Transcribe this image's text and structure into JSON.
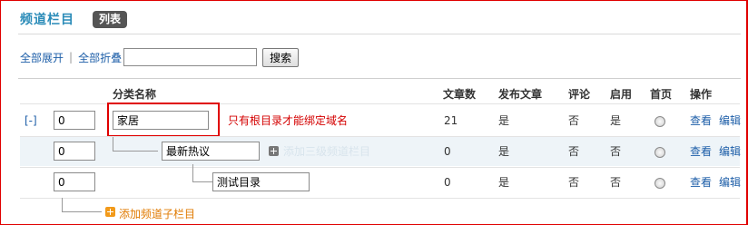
{
  "header": {
    "title": "频道栏目",
    "badge": "列表"
  },
  "toolbar": {
    "expand_all": "全部展开",
    "separator": "|",
    "collapse_all": "全部折叠",
    "search_value": "",
    "search_button": "搜索"
  },
  "columns": {
    "name": "分类名称",
    "articles": "文章数",
    "publish": "发布文章",
    "comment": "评论",
    "enabled": "启用",
    "home": "首页",
    "actions": "操作"
  },
  "rows": [
    {
      "toggle": "[-]",
      "order": "0",
      "name": "家居",
      "hint": "只有根目录才能绑定域名",
      "articles": "21",
      "publish": "是",
      "comment": "否",
      "enabled": "是",
      "home_selected": false,
      "view": "查看",
      "edit": "编辑"
    },
    {
      "order": "0",
      "name": "最新热议",
      "ghost_text": "添加三级频道栏目",
      "articles": "0",
      "publish": "是",
      "comment": "否",
      "enabled": "否",
      "home_selected": false,
      "view": "查看",
      "edit": "编辑"
    },
    {
      "order": "0",
      "name": "测试目录",
      "articles": "0",
      "publish": "是",
      "comment": "否",
      "enabled": "否",
      "home_selected": false,
      "view": "查看",
      "edit": "编辑"
    }
  ],
  "add_sub_channel": "添加频道子栏目",
  "colors": {
    "accent": "#2a8bb8",
    "link": "#1d5ea8",
    "warning": "#d40000",
    "add": "#e07a00",
    "highlight": "#e00000"
  },
  "icons": {
    "add_sub": "plus-square-icon",
    "add_channel": "plus-square-orange-icon"
  }
}
